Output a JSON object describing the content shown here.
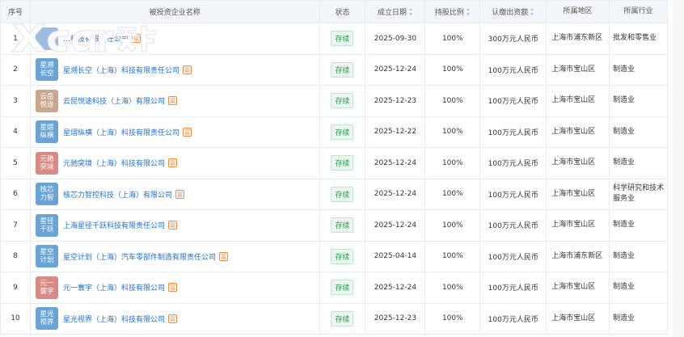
{
  "header": {
    "index": "序号",
    "name": "被投资企业名称",
    "status": "状态",
    "date": "成立日期",
    "share": "持股比例",
    "capital": "认缴出资额",
    "region": "所属地区",
    "industry": "所属行业"
  },
  "watermark": {
    "text": "Xcar爱卡"
  },
  "rows": [
    {
      "index": "1",
      "logo_text": "",
      "logo_color": "#5b8fc9",
      "name": "…科技有限责任公司",
      "rel": "冨",
      "status": "存续",
      "date": "2025-09-30",
      "share": "100%",
      "capital": "300万元人民币",
      "region": "上海市浦东新区",
      "industry": "批发和零售业"
    },
    {
      "index": "2",
      "logo_text": "星溯长空",
      "logo_color": "#6aa3d6",
      "name": "星溯长空（上海）科技有限责任公司",
      "rel": "冨",
      "status": "存续",
      "date": "2025-12-24",
      "share": "100%",
      "capital": "100万元人民币",
      "region": "上海市宝山区",
      "industry": "制造业"
    },
    {
      "index": "3",
      "logo_text": "云岳悦途",
      "logo_color": "#c9a78f",
      "name": "云昆悦途科技（上海）有限公司",
      "rel": "冨",
      "status": "存续",
      "date": "2025-12-23",
      "share": "100%",
      "capital": "100万元人民币",
      "region": "上海市宝山区",
      "industry": "制造业"
    },
    {
      "index": "4",
      "logo_text": "星熠纵横",
      "logo_color": "#6aa3d6",
      "name": "星熠纵横（上海）科技有限责任公司",
      "rel": "冨",
      "status": "存续",
      "date": "2025-12-22",
      "share": "100%",
      "capital": "100万元人民币",
      "region": "上海市宝山区",
      "industry": "制造业"
    },
    {
      "index": "5",
      "logo_text": "元驰突境",
      "logo_color": "#d98a84",
      "name": "元驰突境（上海）科技有限公司",
      "rel": "冨",
      "status": "存续",
      "date": "2025-12-24",
      "share": "100%",
      "capital": "100万元人民币",
      "region": "上海市宝山区",
      "industry": "制造业"
    },
    {
      "index": "6",
      "logo_text": "核芯力智",
      "logo_color": "#6aa3d6",
      "name": "核芯力智控科技（上海）有限公司",
      "rel": "冨",
      "status": "存续",
      "date": "2025-12-24",
      "share": "100%",
      "capital": "100万元人民币",
      "region": "上海市宝山区",
      "industry": "科学研究和技术服务业"
    },
    {
      "index": "7",
      "logo_text": "星径千跃",
      "logo_color": "#6aa3d6",
      "name": "上海星径千跃科技有限责任公司",
      "rel": "冨",
      "status": "存续",
      "date": "2025-12-24",
      "share": "100%",
      "capital": "100万元人民币",
      "region": "上海市宝山区",
      "industry": "制造业"
    },
    {
      "index": "8",
      "logo_text": "星空计划",
      "logo_color": "#6aa3d6",
      "name": "星空计划（上海）汽车零部件制造有限责任公司",
      "rel": "冨",
      "status": "存续",
      "date": "2025-04-14",
      "share": "100%",
      "capital": "100万元人民币",
      "region": "上海市浦东新区",
      "industry": "制造业"
    },
    {
      "index": "9",
      "logo_text": "元一寰宇",
      "logo_color": "#d98a84",
      "name": "元一寰宇（上海）科技有限公司",
      "rel": "冨",
      "status": "存续",
      "date": "2025-12-24",
      "share": "100%",
      "capital": "100万元人民币",
      "region": "上海市宝山区",
      "industry": "制造业"
    },
    {
      "index": "10",
      "logo_text": "星光视界",
      "logo_color": "#6aa3d6",
      "name": "星光视界（上海）科技有限公司",
      "rel": "冨",
      "status": "存续",
      "date": "2025-12-23",
      "share": "100%",
      "capital": "100万元人民币",
      "region": "上海市宝山区",
      "industry": "制造业"
    }
  ]
}
